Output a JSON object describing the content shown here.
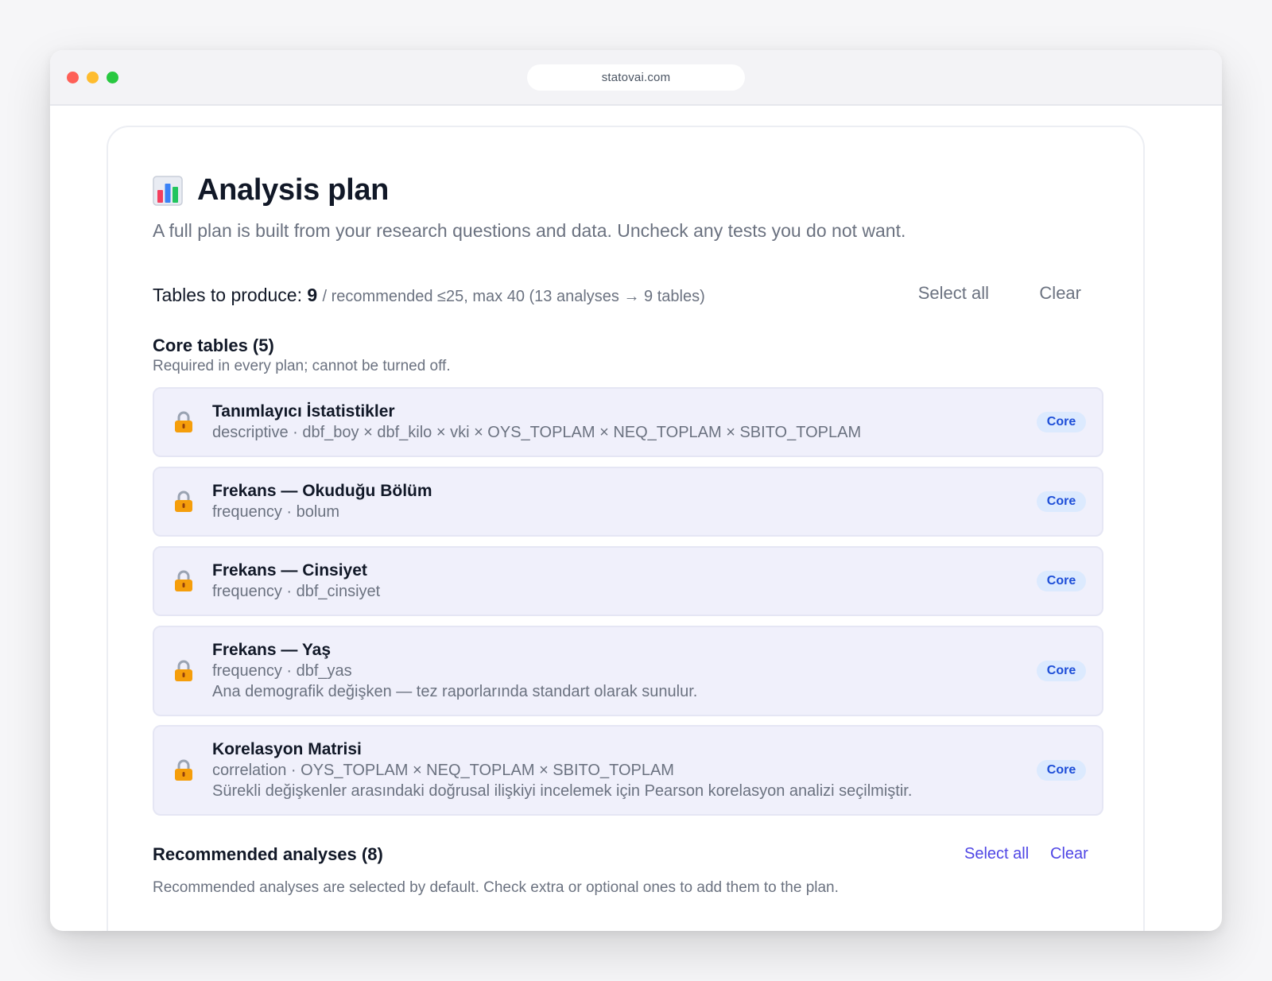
{
  "browser": {
    "url": "statovai.com"
  },
  "header": {
    "title": "Analysis plan",
    "subtitle": "A full plan is built from your research questions and data. Uncheck any tests you do not want."
  },
  "summary": {
    "label": "Tables to produce:",
    "count": "9",
    "detail": "/ recommended ≤25, max 40 (13 analyses → 9 tables)",
    "select_all_label": "Select all",
    "clear_label": "Clear"
  },
  "core": {
    "title": "Core tables (5)",
    "description": "Required in every plan; cannot be turned off.",
    "badge_label": "Core",
    "items": [
      {
        "title": "Tanımlayıcı İstatistikler",
        "meta": "descriptive · dbf_boy × dbf_kilo × vki × OYS_TOPLAM × NEQ_TOPLAM × SBITO_TOPLAM",
        "note": ""
      },
      {
        "title": "Frekans — Okuduğu Bölüm",
        "meta": "frequency · bolum",
        "note": ""
      },
      {
        "title": "Frekans — Cinsiyet",
        "meta": "frequency · dbf_cinsiyet",
        "note": ""
      },
      {
        "title": "Frekans — Yaş",
        "meta": "frequency · dbf_yas",
        "note": "Ana demografik değişken — tez raporlarında standart olarak sunulur."
      },
      {
        "title": "Korelasyon Matrisi",
        "meta": "correlation · OYS_TOPLAM × NEQ_TOPLAM × SBITO_TOPLAM",
        "note": "Sürekli değişkenler arasındaki doğrusal ilişkiyi incelemek için Pearson korelasyon analizi seçilmiştir."
      }
    ]
  },
  "recommended": {
    "title": "Recommended analyses (8)",
    "description": "Recommended analyses are selected by default. Check extra or optional ones to add them to the plan.",
    "select_all_label": "Select all",
    "clear_label": "Clear"
  },
  "colors": {
    "accent": "#4f46e5",
    "core_badge_bg": "#dceafe",
    "core_badge_text": "#1d4ed8",
    "core_row_bg": "#f0f0fb"
  },
  "icons": {
    "heading": "bar-chart-icon",
    "core_item": "lock-icon"
  }
}
